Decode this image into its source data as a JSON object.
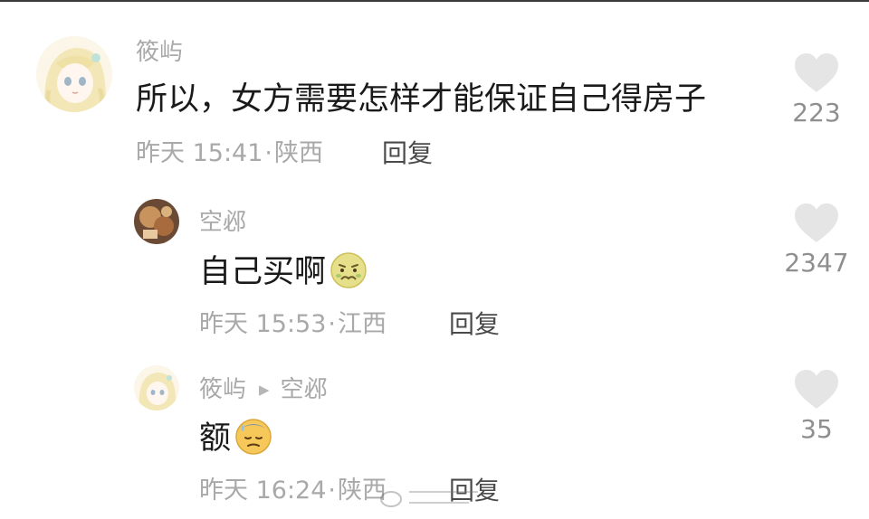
{
  "comments": [
    {
      "username": "筱屿",
      "text": "所以，女方需要怎样才能保证自己得房子",
      "time": "昨天 15:41",
      "location": "陕西",
      "reply_label": "回复",
      "likes": "223"
    },
    {
      "username": "空邲",
      "text": "自己买啊",
      "emoji": "nauseated-face-emoji",
      "time": "昨天 15:53",
      "location": "江西",
      "reply_label": "回复",
      "likes": "2347"
    },
    {
      "username": "筱屿",
      "reply_to": "空邲",
      "text": "额",
      "emoji": "sweat-face-emoji",
      "time": "昨天 16:24",
      "location": "陕西",
      "reply_label": "回复",
      "likes": "35"
    }
  ],
  "colors": {
    "meta_gray": "#a9a9a9",
    "text": "#1a1a1a",
    "heart": "#e5e5e5"
  },
  "icons": {
    "like": "heart-icon",
    "reply_arrow": "right-triangle-icon"
  }
}
